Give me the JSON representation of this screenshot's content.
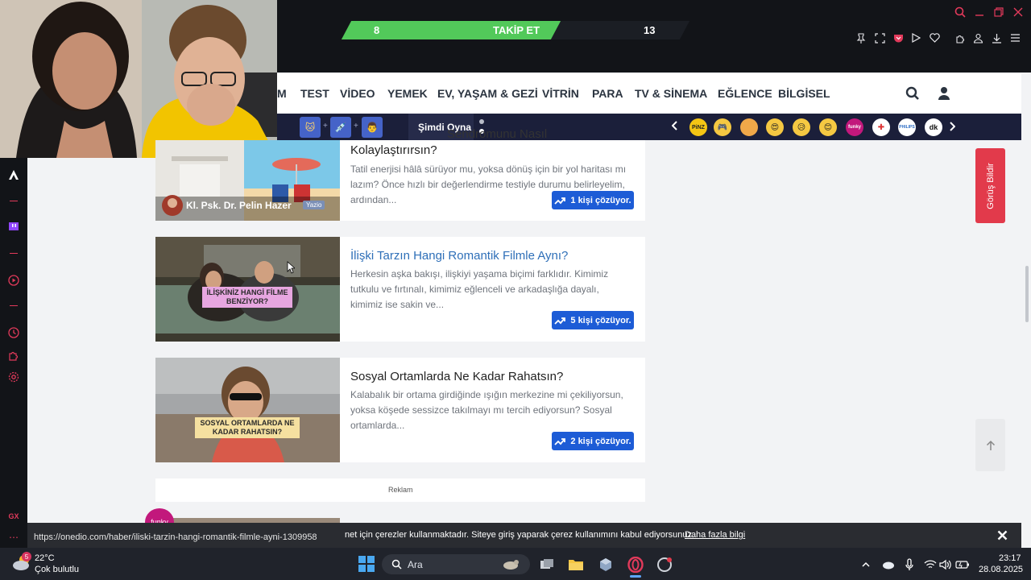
{
  "stream_banner": {
    "left_count": "8",
    "follow_label": "TAKİP ET",
    "right_count": "13"
  },
  "nav": {
    "items": [
      "M",
      "TEST",
      "VİDEO",
      "YEMEK",
      "EV, YAŞAM & GEZİ",
      "VİTRİN",
      "PARA",
      "TV & SİNEMA",
      "EĞLENCE",
      "BİLGİSEL"
    ]
  },
  "play_strip": {
    "cta": "Şimdi Oyna",
    "emoji_labels": [
      "PiNZ",
      "",
      "",
      "",
      "",
      "",
      "funky",
      "",
      "PHILIPS",
      "dk"
    ]
  },
  "cards": [
    {
      "title_partial": "Sendromunu Nasıl",
      "title": "Kolaylaştırırsın?",
      "desc": "Tatil enerjisi hâlâ sürüyor mu, yoksa dönüş için bir yol haritası mı lazım? Önce hızlı bir değerlendirme testiyle durumu belirleyelim, ardından...",
      "author": "Kl. Psk. Dr. Pelin Hazer",
      "author_badge": "Yazio",
      "solvers": "1 kişi çözüyor."
    },
    {
      "title": "İlişki Tarzın Hangi Romantik Filmle Aynı?",
      "desc": "Herkesin aşka bakışı, ilişkiyi yaşama biçimi farklıdır. Kimimiz tutkulu ve fırtınalı, kimimiz eğlenceli ve arkadaşlığa dayalı, kimimiz ise sakin ve...",
      "thumb_text": "İLİŞKİNİZ HANGİ FİLME BENZİYOR?",
      "solvers": "5 kişi çözüyor."
    },
    {
      "title": "Sosyal Ortamlarda Ne Kadar Rahatsın?",
      "desc": "Kalabalık bir ortama girdiğinde ışığın merkezine mi çekiliyorsun, yoksa köşede sessizce takılmayı mı tercih ediyorsun? Sosyal ortamlarda...",
      "thumb_text": "SOSYAL ORTAMLARDA NE KADAR RAHATSIN?",
      "solvers": "2 kişi çözüyor."
    }
  ],
  "ad_label": "Reklam",
  "feedback_label": "Görüş Bildir",
  "cookie": {
    "text": "net için çerezler kullanmaktadır. Siteye giriş yaparak çerez kullanımını kabul ediyorsunuz.",
    "link": "Daha fazla bilgi"
  },
  "status_url": "https://onedio.com/haber/iliski-tarzin-hangi-romantik-filmle-ayni-1309958",
  "taskbar": {
    "weather_temp": "22°C",
    "weather_desc": "Çok bulutlu",
    "weather_badge": "5",
    "search_placeholder": "Ara",
    "time": "23:17",
    "date": "28.08.2025"
  },
  "colors": {
    "accent_red": "#e23a5b",
    "follow_green": "#52c95a",
    "button_blue": "#1d5cd6",
    "title_link_blue": "#2e6fb8"
  }
}
